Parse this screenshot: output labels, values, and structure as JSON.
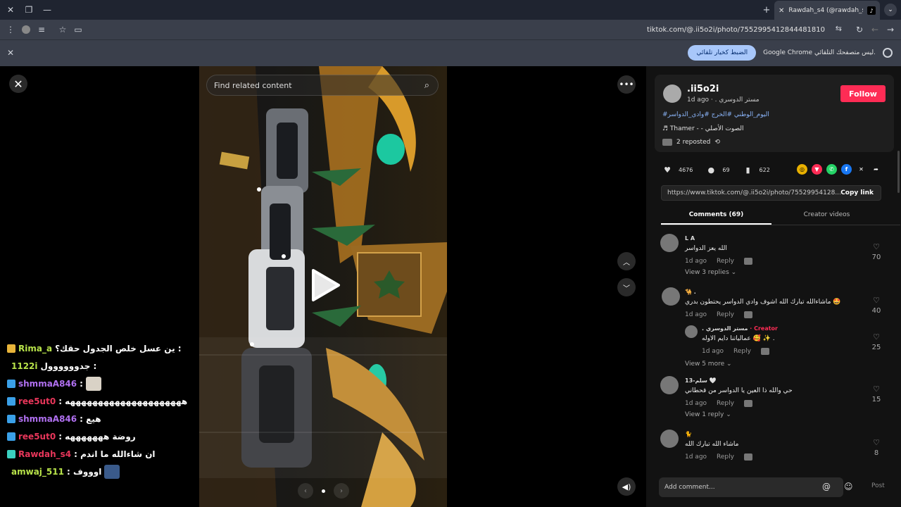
{
  "browser": {
    "tab_title": "Rawdah_s4 (@rawdah_s4) |",
    "url": "tiktok.com/@.ii5o2i/photo/7552995412844481810",
    "infobar_button": "الضبط كخيار تلقائي",
    "infobar_text": "Google Chrome ليس متصفحك التلقائي."
  },
  "viewer": {
    "search_placeholder": "Find related content"
  },
  "chat": [
    {
      "user": "Rima_a",
      "msg": "ين عسل خلص الجدول حقك؟ :",
      "color": "#b8e34a",
      "badge_color": "#e8b43a",
      "badge": "■"
    },
    {
      "user": "1122i",
      "msg": "جدوووووول :",
      "color": "#b8e34a",
      "badge_color": "",
      "badge": ""
    },
    {
      "user": "shmmaA846",
      "msg": ":",
      "color": "#b070f0",
      "badge_color": "#3aa0e8",
      "badge": "◩"
    },
    {
      "user": "ree5ut0",
      "msg": ": هههههههههههههههههههههه",
      "color": "#e8365a",
      "badge_color": "#3aa0e8",
      "badge": "◩"
    },
    {
      "user": "shmmaA846",
      "msg": ": هيع",
      "color": "#b070f0",
      "badge_color": "#3aa0e8",
      "badge": "◩"
    },
    {
      "user": "ree5ut0",
      "msg": ": روضة هههههههه",
      "color": "#e8365a",
      "badge_color": "#3aa0e8",
      "badge": "◩"
    },
    {
      "user": "Rawdah_s4",
      "msg": ": ان شاءالله ما اندم",
      "color": "#e8365a",
      "badge_color": "#3ad0c0",
      "badge": "▣"
    },
    {
      "user": "amwaj_511",
      "msg": ": اوووف",
      "color": "#b8e34a",
      "badge_color": "",
      "badge": ""
    }
  ],
  "author": {
    "username": ".ii5o2i",
    "meta": "1d ago · . مستر الدوسري",
    "follow": "Follow",
    "hashtags": "#اليوم_الوطني #الخرج #وادي_الدواسر",
    "music": "♬ Thamer - - الصوت الأصلي",
    "reposted": "2 reposted"
  },
  "stats": {
    "likes": "4676",
    "comments": "69",
    "saves": "622"
  },
  "link": {
    "url": "https://www.tiktok.com/@.ii5o2i/photo/75529954128...",
    "copy": "Copy link"
  },
  "tabs": {
    "comments": "Comments (69)",
    "creator": "Creator videos"
  },
  "comments": [
    {
      "name": "L A",
      "text": "الله يعز الدواسر",
      "time": "1d ago",
      "reply": "Reply",
      "likes": "70",
      "more": "View 3 replies ⌄"
    },
    {
      "name": "🐪 .",
      "text": "ماشاءالله تبارك الله اشوف وادي الدواسر يحتطون بدري 🤩",
      "time": "1d ago",
      "reply": "Reply",
      "likes": "40",
      "more": ""
    },
    {
      "name": ". مستر الدوسري",
      "creator": "· Creator",
      "text": "عمالياتنا دايم الاوله 🥰 ✨ .",
      "time": "1d ago",
      "reply": "Reply",
      "likes": "25",
      "more": "View 5 more ⌄"
    },
    {
      "name": "سلم-13 🤍",
      "text": "حي والله ذا العين يا الدواسر من قحطاني",
      "time": "1d ago",
      "reply": "Reply",
      "likes": "15",
      "more": "View 1 reply ⌄"
    },
    {
      "name": "🐈",
      "text": "ماشاء الله تبارك الله",
      "time": "1d ago",
      "reply": "Reply",
      "likes": "8",
      "more": ""
    }
  ],
  "add_comment": {
    "placeholder": "Add comment...",
    "post": "Post"
  }
}
